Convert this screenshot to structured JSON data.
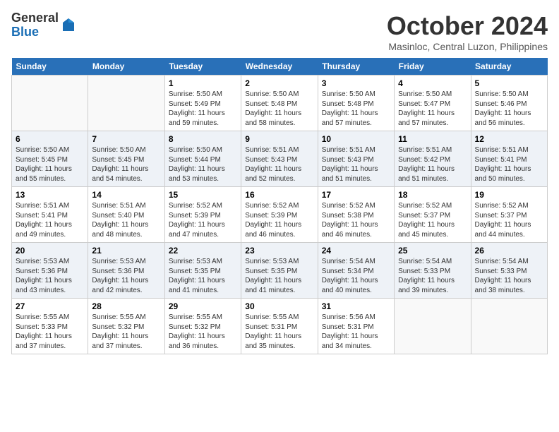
{
  "logo": {
    "general": "General",
    "blue": "Blue"
  },
  "title": "October 2024",
  "location": "Masinloc, Central Luzon, Philippines",
  "days": [
    "Sunday",
    "Monday",
    "Tuesday",
    "Wednesday",
    "Thursday",
    "Friday",
    "Saturday"
  ],
  "weeks": [
    [
      {
        "date": "",
        "sunrise": "",
        "sunset": "",
        "daylight": ""
      },
      {
        "date": "",
        "sunrise": "",
        "sunset": "",
        "daylight": ""
      },
      {
        "date": "1",
        "sunrise": "Sunrise: 5:50 AM",
        "sunset": "Sunset: 5:49 PM",
        "daylight": "Daylight: 11 hours and 59 minutes."
      },
      {
        "date": "2",
        "sunrise": "Sunrise: 5:50 AM",
        "sunset": "Sunset: 5:48 PM",
        "daylight": "Daylight: 11 hours and 58 minutes."
      },
      {
        "date": "3",
        "sunrise": "Sunrise: 5:50 AM",
        "sunset": "Sunset: 5:48 PM",
        "daylight": "Daylight: 11 hours and 57 minutes."
      },
      {
        "date": "4",
        "sunrise": "Sunrise: 5:50 AM",
        "sunset": "Sunset: 5:47 PM",
        "daylight": "Daylight: 11 hours and 57 minutes."
      },
      {
        "date": "5",
        "sunrise": "Sunrise: 5:50 AM",
        "sunset": "Sunset: 5:46 PM",
        "daylight": "Daylight: 11 hours and 56 minutes."
      }
    ],
    [
      {
        "date": "6",
        "sunrise": "Sunrise: 5:50 AM",
        "sunset": "Sunset: 5:45 PM",
        "daylight": "Daylight: 11 hours and 55 minutes."
      },
      {
        "date": "7",
        "sunrise": "Sunrise: 5:50 AM",
        "sunset": "Sunset: 5:45 PM",
        "daylight": "Daylight: 11 hours and 54 minutes."
      },
      {
        "date": "8",
        "sunrise": "Sunrise: 5:50 AM",
        "sunset": "Sunset: 5:44 PM",
        "daylight": "Daylight: 11 hours and 53 minutes."
      },
      {
        "date": "9",
        "sunrise": "Sunrise: 5:51 AM",
        "sunset": "Sunset: 5:43 PM",
        "daylight": "Daylight: 11 hours and 52 minutes."
      },
      {
        "date": "10",
        "sunrise": "Sunrise: 5:51 AM",
        "sunset": "Sunset: 5:43 PM",
        "daylight": "Daylight: 11 hours and 51 minutes."
      },
      {
        "date": "11",
        "sunrise": "Sunrise: 5:51 AM",
        "sunset": "Sunset: 5:42 PM",
        "daylight": "Daylight: 11 hours and 51 minutes."
      },
      {
        "date": "12",
        "sunrise": "Sunrise: 5:51 AM",
        "sunset": "Sunset: 5:41 PM",
        "daylight": "Daylight: 11 hours and 50 minutes."
      }
    ],
    [
      {
        "date": "13",
        "sunrise": "Sunrise: 5:51 AM",
        "sunset": "Sunset: 5:41 PM",
        "daylight": "Daylight: 11 hours and 49 minutes."
      },
      {
        "date": "14",
        "sunrise": "Sunrise: 5:51 AM",
        "sunset": "Sunset: 5:40 PM",
        "daylight": "Daylight: 11 hours and 48 minutes."
      },
      {
        "date": "15",
        "sunrise": "Sunrise: 5:52 AM",
        "sunset": "Sunset: 5:39 PM",
        "daylight": "Daylight: 11 hours and 47 minutes."
      },
      {
        "date": "16",
        "sunrise": "Sunrise: 5:52 AM",
        "sunset": "Sunset: 5:39 PM",
        "daylight": "Daylight: 11 hours and 46 minutes."
      },
      {
        "date": "17",
        "sunrise": "Sunrise: 5:52 AM",
        "sunset": "Sunset: 5:38 PM",
        "daylight": "Daylight: 11 hours and 46 minutes."
      },
      {
        "date": "18",
        "sunrise": "Sunrise: 5:52 AM",
        "sunset": "Sunset: 5:37 PM",
        "daylight": "Daylight: 11 hours and 45 minutes."
      },
      {
        "date": "19",
        "sunrise": "Sunrise: 5:52 AM",
        "sunset": "Sunset: 5:37 PM",
        "daylight": "Daylight: 11 hours and 44 minutes."
      }
    ],
    [
      {
        "date": "20",
        "sunrise": "Sunrise: 5:53 AM",
        "sunset": "Sunset: 5:36 PM",
        "daylight": "Daylight: 11 hours and 43 minutes."
      },
      {
        "date": "21",
        "sunrise": "Sunrise: 5:53 AM",
        "sunset": "Sunset: 5:36 PM",
        "daylight": "Daylight: 11 hours and 42 minutes."
      },
      {
        "date": "22",
        "sunrise": "Sunrise: 5:53 AM",
        "sunset": "Sunset: 5:35 PM",
        "daylight": "Daylight: 11 hours and 41 minutes."
      },
      {
        "date": "23",
        "sunrise": "Sunrise: 5:53 AM",
        "sunset": "Sunset: 5:35 PM",
        "daylight": "Daylight: 11 hours and 41 minutes."
      },
      {
        "date": "24",
        "sunrise": "Sunrise: 5:54 AM",
        "sunset": "Sunset: 5:34 PM",
        "daylight": "Daylight: 11 hours and 40 minutes."
      },
      {
        "date": "25",
        "sunrise": "Sunrise: 5:54 AM",
        "sunset": "Sunset: 5:33 PM",
        "daylight": "Daylight: 11 hours and 39 minutes."
      },
      {
        "date": "26",
        "sunrise": "Sunrise: 5:54 AM",
        "sunset": "Sunset: 5:33 PM",
        "daylight": "Daylight: 11 hours and 38 minutes."
      }
    ],
    [
      {
        "date": "27",
        "sunrise": "Sunrise: 5:55 AM",
        "sunset": "Sunset: 5:33 PM",
        "daylight": "Daylight: 11 hours and 37 minutes."
      },
      {
        "date": "28",
        "sunrise": "Sunrise: 5:55 AM",
        "sunset": "Sunset: 5:32 PM",
        "daylight": "Daylight: 11 hours and 37 minutes."
      },
      {
        "date": "29",
        "sunrise": "Sunrise: 5:55 AM",
        "sunset": "Sunset: 5:32 PM",
        "daylight": "Daylight: 11 hours and 36 minutes."
      },
      {
        "date": "30",
        "sunrise": "Sunrise: 5:55 AM",
        "sunset": "Sunset: 5:31 PM",
        "daylight": "Daylight: 11 hours and 35 minutes."
      },
      {
        "date": "31",
        "sunrise": "Sunrise: 5:56 AM",
        "sunset": "Sunset: 5:31 PM",
        "daylight": "Daylight: 11 hours and 34 minutes."
      },
      {
        "date": "",
        "sunrise": "",
        "sunset": "",
        "daylight": ""
      },
      {
        "date": "",
        "sunrise": "",
        "sunset": "",
        "daylight": ""
      }
    ]
  ]
}
